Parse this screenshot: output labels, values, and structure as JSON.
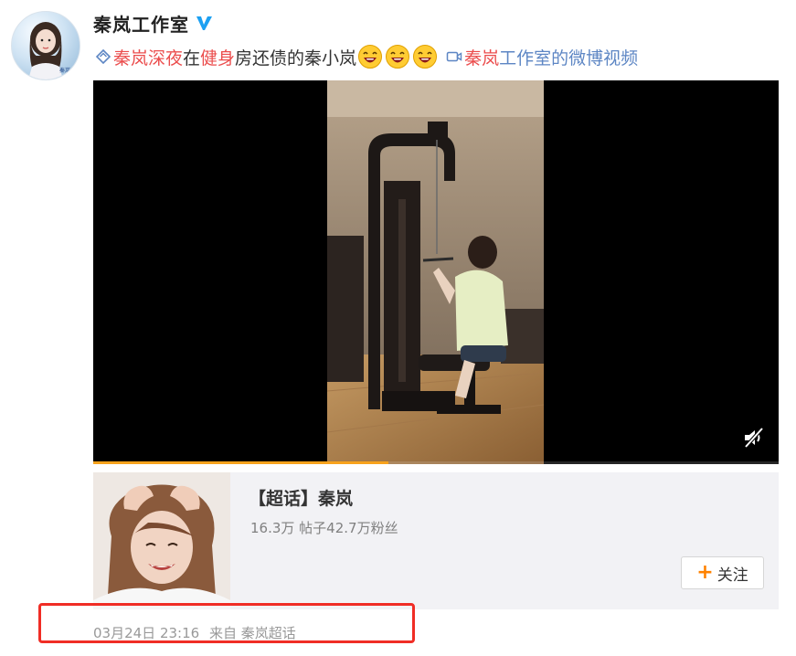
{
  "author": {
    "name": "秦岚工作室",
    "verified_icon": "verified-v-icon"
  },
  "post": {
    "topic_link": "秦岚深夜",
    "text_1": "在",
    "highlight_word": "健身",
    "text_2": "房还债的秦小岚",
    "emojis": [
      "laughing-emoji",
      "laughing-emoji",
      "laughing-emoji"
    ],
    "video_link_red": "秦岚",
    "video_link_blue": "工作室的微博视频"
  },
  "video": {
    "progress_fraction": 0.43,
    "mute_icon": "muted-speaker-icon"
  },
  "super_topic": {
    "title": "【超话】秦岚",
    "stats": "16.3万 帖子42.7万粉丝",
    "follow_label": "关注",
    "follow_icon": "plus-icon"
  },
  "meta": {
    "time": "03月24日 23:16",
    "source": "来自 秦岚超话"
  },
  "colors": {
    "link_red": "#eb4d4d",
    "link_blue": "#5d86c4",
    "progress": "#f7a21c",
    "highlight_box": "#f02d25",
    "follow_plus": "#ff8200"
  }
}
